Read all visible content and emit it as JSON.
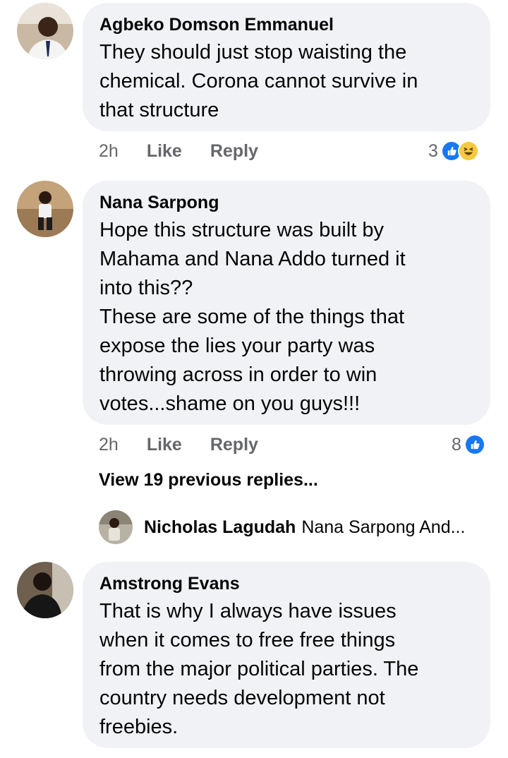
{
  "comments": [
    {
      "author": "Agbeko Domson Emmanuel",
      "lines": [
        "They should just stop waisting the",
        "chemical. Corona cannot survive in",
        "that structure"
      ],
      "time": "2h",
      "like_label": "Like",
      "reply_label": "Reply",
      "reaction_count": "3",
      "reactions": [
        "like-icon",
        "haha-icon"
      ]
    },
    {
      "author": "Nana Sarpong",
      "lines": [
        "Hope this structure was built by",
        "Mahama and Nana Addo turned it",
        "into this??",
        "These are some of the things that",
        "expose the lies your party was",
        "throwing across in order to win",
        "votes...shame on you guys!!!"
      ],
      "time": "2h",
      "like_label": "Like",
      "reply_label": "Reply",
      "reaction_count": "8",
      "reactions": [
        "like-icon"
      ]
    },
    {
      "author": "Amstrong Evans",
      "lines": [
        "That is why I always have issues",
        "when it comes to free free things",
        "from the major political parties. The",
        "country needs development not",
        "freebies."
      ]
    }
  ],
  "view_previous": "View 19 previous replies...",
  "reply_preview": {
    "author": "Nicholas Lagudah",
    "snippet": "Nana Sarpong And..."
  },
  "colors": {
    "bubble": "#f0f2f5",
    "meta_text": "#65676b",
    "like_blue": "#1877f2",
    "haha_yellow": "#f7c940"
  }
}
